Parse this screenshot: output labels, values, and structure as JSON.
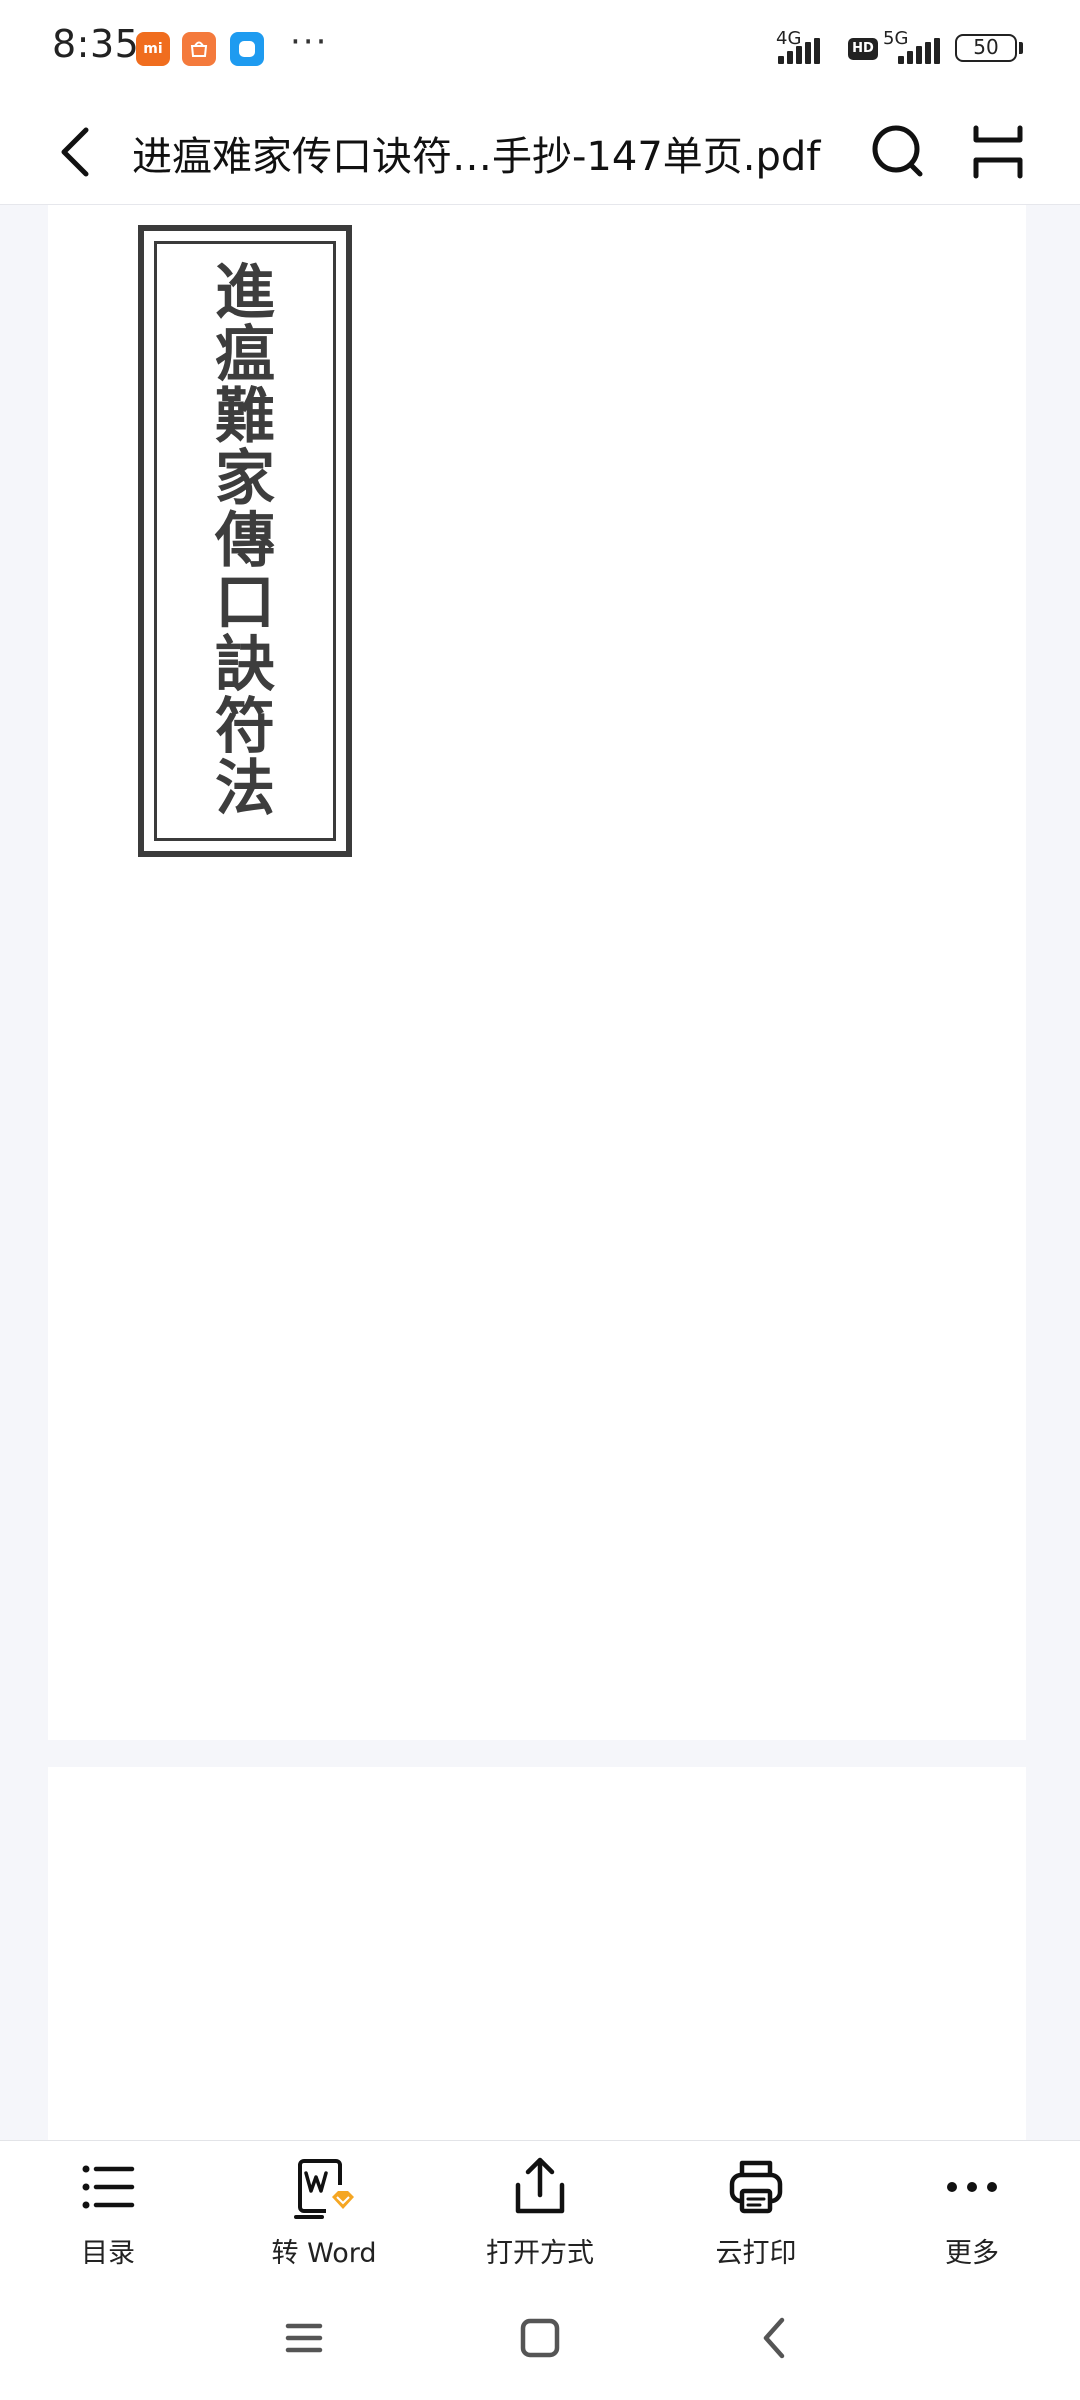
{
  "status_bar": {
    "time": "8:35",
    "more": "···",
    "net1": "4G",
    "net2": "5G",
    "hd": "HD",
    "battery": "50",
    "app_icons": [
      "mi-app-icon",
      "mall-app-icon",
      "cloud-app-icon"
    ]
  },
  "title_bar": {
    "title": "进瘟难家传口诀符…手抄-147单页.pdf"
  },
  "document": {
    "title_slip_chars": [
      "進",
      "瘟",
      "難",
      "家",
      "傳",
      "口",
      "訣",
      "符",
      "法"
    ]
  },
  "toolbar": {
    "items": [
      {
        "label": "目录",
        "icon": "list-icon"
      },
      {
        "label": "转 Word",
        "icon": "word-convert-icon"
      },
      {
        "label": "打开方式",
        "icon": "share-icon"
      },
      {
        "label": "云打印",
        "icon": "printer-icon"
      },
      {
        "label": "更多",
        "icon": "more-icon"
      }
    ]
  },
  "colors": {
    "accent_orange": "#f5a623",
    "mi_orange": "#f06d1e",
    "cloud_blue": "#1e9bf0"
  }
}
